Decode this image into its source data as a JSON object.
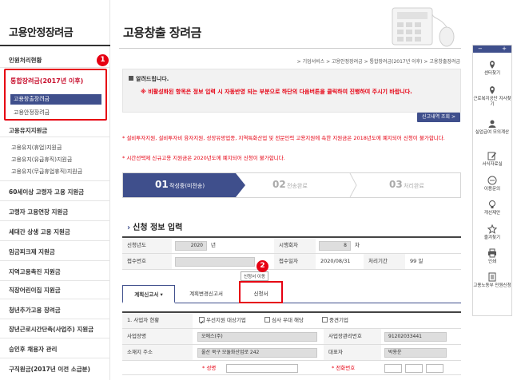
{
  "sidebar": {
    "title": "고용안정장려금",
    "items": [
      {
        "label": "인원처리현황"
      },
      {
        "label": "고용유지지원금"
      },
      {
        "label": "60세이상 고령자 고용 지원금"
      },
      {
        "label": "고령자 고용연장 지원금"
      },
      {
        "label": "세대간 상생 고용 지원금"
      },
      {
        "label": "임금피크제 지원금"
      },
      {
        "label": "지역고용촉진 지원금"
      },
      {
        "label": "직장어린이집 지원금"
      },
      {
        "label": "청년추가고용 장려금"
      },
      {
        "label": "장년근로시간단축(사업주) 지원금"
      },
      {
        "label": "승인후 채용자 관리"
      },
      {
        "label": "구직원금(2017년 이전 소급분)"
      }
    ],
    "group": {
      "title": "통합장려금(2017년 이후)",
      "active": "고용창출장려금",
      "sub": "고용안정장려금"
    },
    "retention_subs": [
      "고용유지(휴업)지원금",
      "고용유지(유급휴직)지원금",
      "고용유지(무급휴업휴직)지원금"
    ]
  },
  "badges": {
    "one": "1",
    "two": "2"
  },
  "main": {
    "title": "고용창출 장려금",
    "breadcrumb": "> 기업서비스 > 고용안정장려금 > 통합장려금(2017년 이후) > 고용창출장려금",
    "notice_head": "알려드립니다.",
    "notice_text": "※ 비활성화된 항목은 정보 입력 시 자동반영 되는 부분으로 하단의 다음버튼을 클릭하여 진행하여 주시기 바랍니다.",
    "lookup_button": "신고내역 조회 >",
    "notes": [
      "* 설비투자지원, 설비투자비 융자지원, 성장유망업종, 지역특화산업 및 전문인력 고용지원에 속한 지원금은 2018년도에 폐지되어 신청이 불가합니다.",
      "* 시간선택제 신규고용 지원금은 2020년도에 폐지되어 신청이 불가합니다."
    ],
    "steps": [
      {
        "num": "01",
        "label": "작성중(미전송)"
      },
      {
        "num": "02",
        "label": "전송완료"
      },
      {
        "num": "03",
        "label": "처리완료"
      }
    ],
    "section_title": "신청 정보 입력",
    "info": {
      "year_label": "신청년도",
      "year_value": "2020",
      "year_unit": "년",
      "round_label": "시행회차",
      "round_value": "8",
      "round_unit": "차",
      "receipt_label": "접수번호",
      "receipt_value": "",
      "date_label": "접수일자",
      "date_value": "2020/08/31",
      "period_label": "처리기간",
      "period_value": "99 일"
    },
    "tabs": [
      {
        "label": "계획신고서 ▾"
      },
      {
        "label": "계획변경신고서"
      },
      {
        "label": "신청서"
      }
    ],
    "tooltip": "신청서 이동",
    "form": {
      "row1_label": "1. 사업자 현황",
      "checks": [
        {
          "label": "우선지원 대상기업",
          "checked": true
        },
        {
          "label": "심사 우대 해당",
          "checked": false
        },
        {
          "label": "중견기업",
          "checked": false
        }
      ],
      "company_label": "사업장명",
      "company_value": "오에스(주)",
      "bizno_label": "사업장관리번호",
      "bizno_value": "91202033441",
      "address_label": "소재지 주소",
      "address_value": "울산 북구 모듈화산업로 242",
      "ceo_label": "대표자",
      "ceo_value": "박용운",
      "name_label": "* 성명",
      "phone_label": "* 전화번호"
    }
  },
  "quick": {
    "items": [
      {
        "label": "센터찾기",
        "icon": "map-pin-icon"
      },
      {
        "label": "근로복지공단 지사찾기",
        "icon": "map-pin-icon"
      },
      {
        "label": "실업급여 모의계산",
        "icon": "user-icon"
      },
      {
        "label": "서식자료실",
        "icon": "edit-icon"
      },
      {
        "label": "이용문의",
        "icon": "chat-icon"
      },
      {
        "label": "개선제안",
        "icon": "lightbulb-icon"
      },
      {
        "label": "즐겨찾기",
        "icon": "star-icon"
      },
      {
        "label": "인쇄",
        "icon": "print-icon"
      },
      {
        "label": "고용노동부 민원신청",
        "icon": "document-icon"
      }
    ]
  },
  "colors": {
    "accent": "#3f4f8c",
    "alert": "#e60012"
  }
}
